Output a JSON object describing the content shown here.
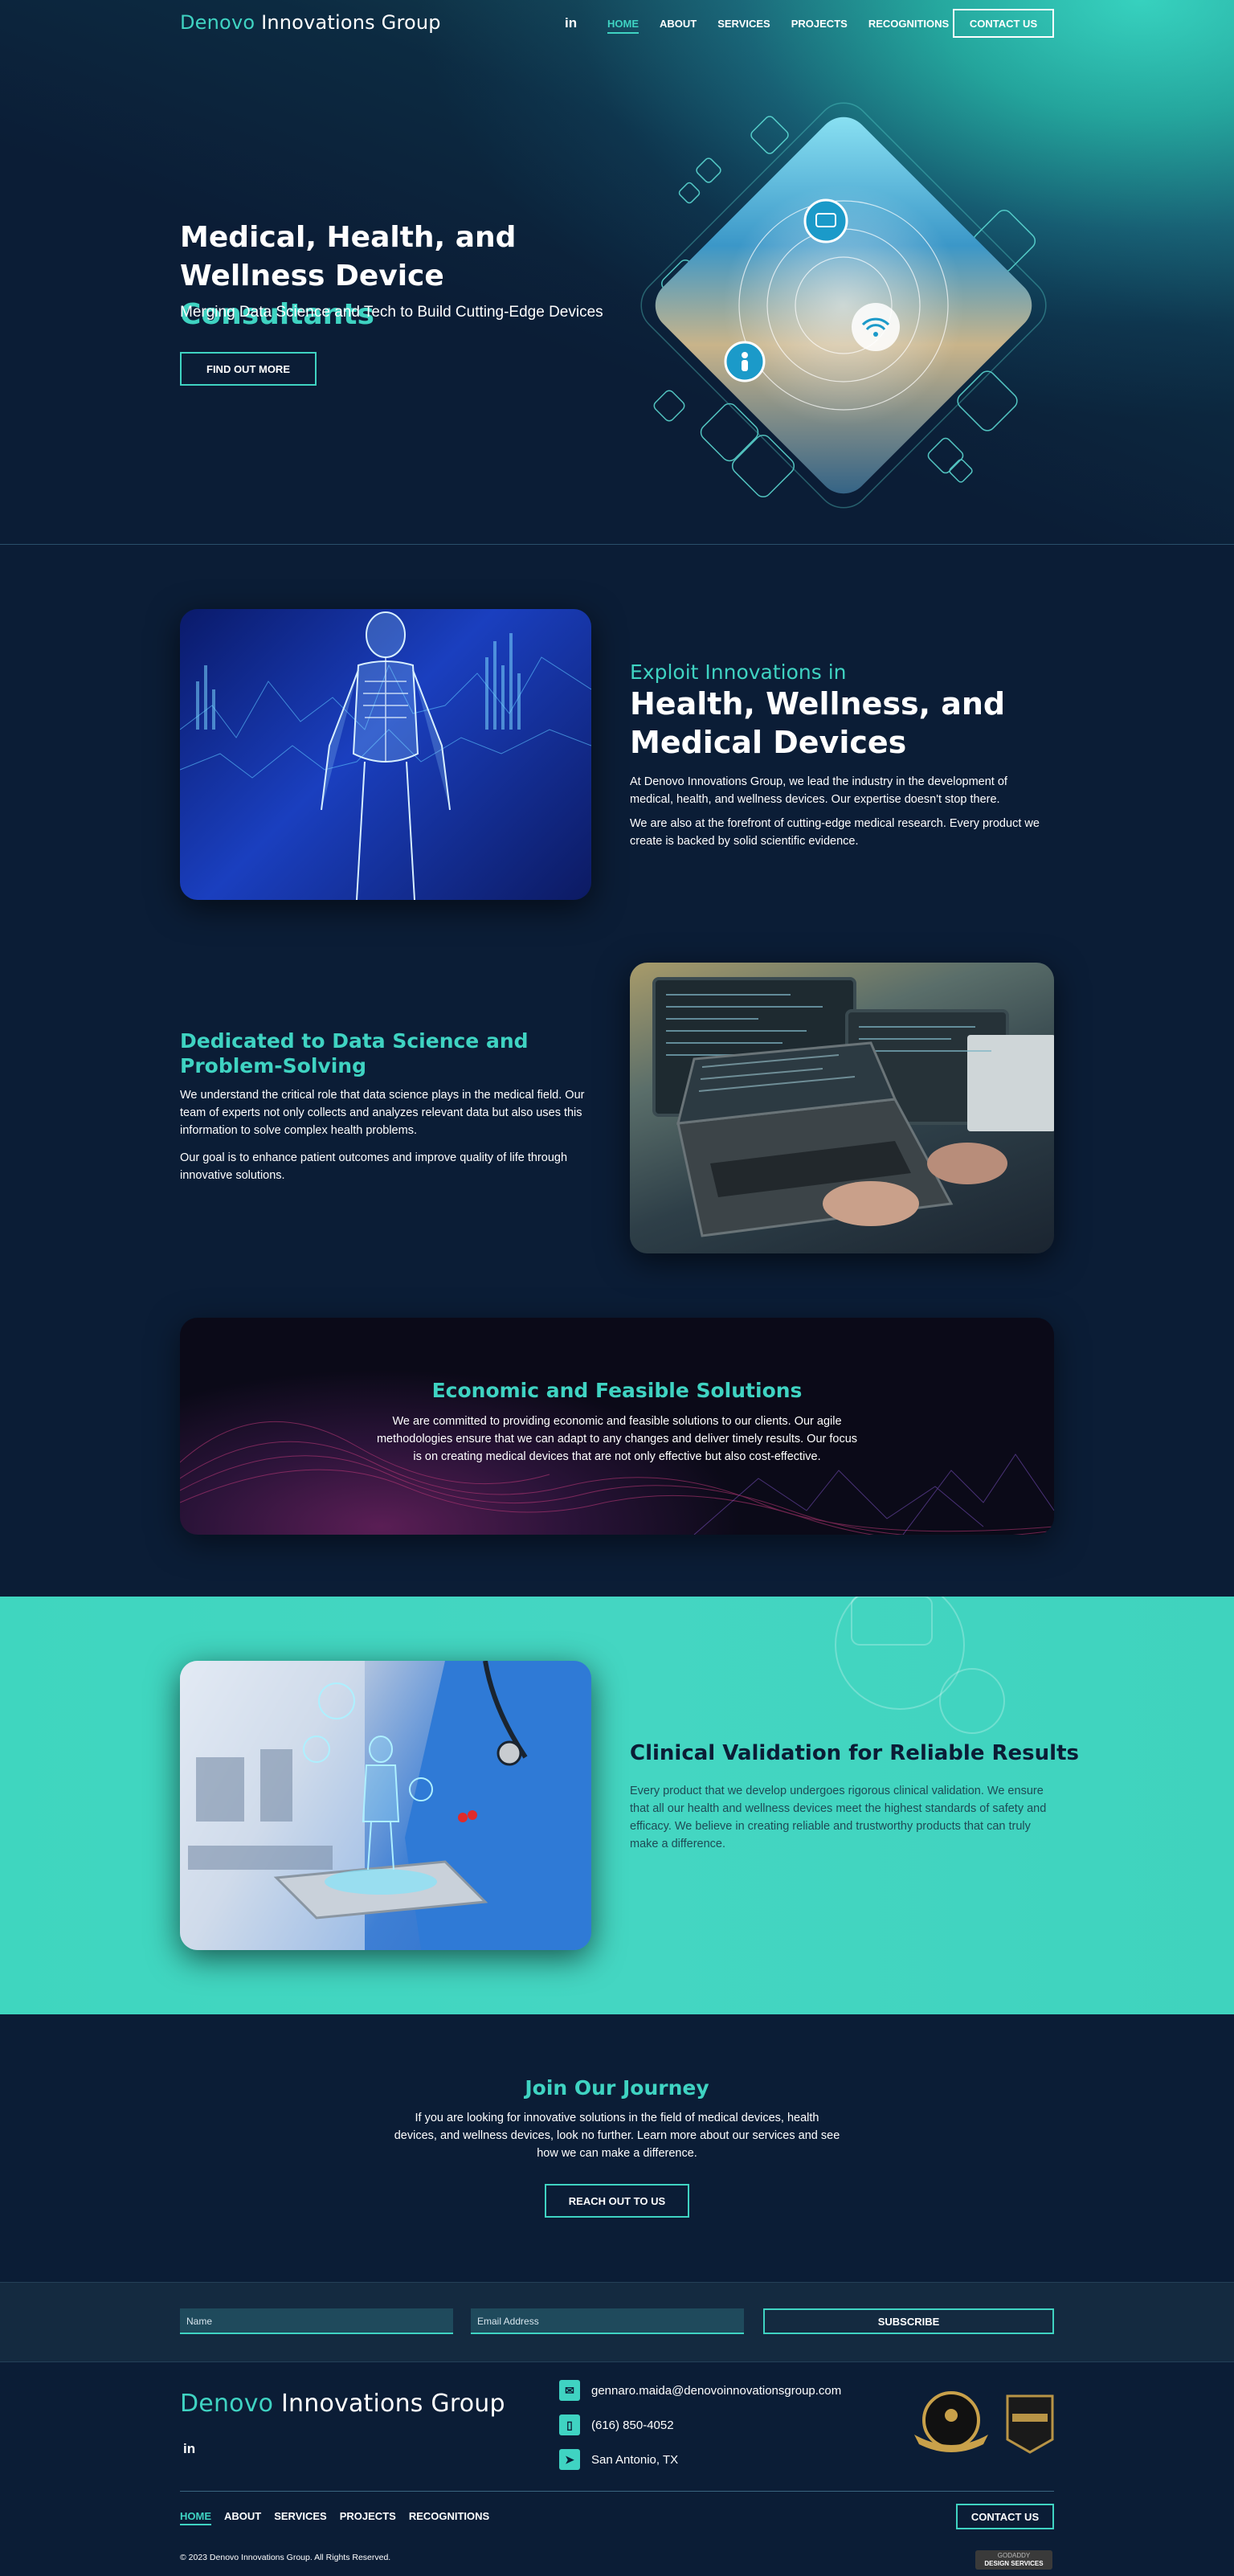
{
  "brand": {
    "accent": "Denovo",
    "rest": " Innovations Group"
  },
  "colors": {
    "accent": "#3fd3c2",
    "navy": "#0b1d36",
    "teal_bg": "#44d6c2"
  },
  "header": {
    "linkedin_glyph": "in",
    "nav": [
      "HOME",
      "ABOUT",
      "SERVICES",
      "PROJECTS",
      "RECOGNITIONS"
    ],
    "active_nav": "HOME",
    "contact_label": "CONTACT US"
  },
  "hero": {
    "title_line1": "Medical, Health, and",
    "title_line2_a": "Wellness Device ",
    "title_line2_b": "Consultants",
    "subtitle": "Merging Data Science and Tech to Build Cutting-Edge Devices",
    "cta_label": "FIND OUT MORE"
  },
  "innovations": {
    "eyebrow": "Exploit Innovations in",
    "heading_line1": "Health, Wellness, and",
    "heading_line2": "Medical Devices",
    "p1": "At Denovo Innovations Group, we lead the industry in the development of medical, health, and wellness devices. Our expertise doesn't stop there.",
    "p2": "We are also at the forefront of cutting-edge medical research. Every product we create is backed by solid scientific evidence."
  },
  "data_science": {
    "heading": "Dedicated to Data Science and Problem-Solving",
    "p1": "We understand the critical role that data science plays in the medical field. Our team of experts not only collects and analyzes relevant data but also uses this information to solve complex health problems.",
    "p2": "Our goal is to enhance patient outcomes and improve quality of life through innovative solutions."
  },
  "economic": {
    "heading": "Economic and Feasible Solutions",
    "text": "We are committed to providing economic and feasible solutions to our clients. Our agile methodologies ensure that we can adapt to any changes and deliver timely results. Our focus is on creating medical devices that are not only effective but also cost-effective."
  },
  "clinical": {
    "heading": "Clinical Validation for Reliable Results",
    "text": "Every product that we develop undergoes rigorous clinical validation. We ensure that all our health and wellness devices meet the highest standards of safety and efficacy. We believe in creating reliable and trustworthy products that can truly make a difference."
  },
  "join": {
    "heading": "Join Our Journey",
    "text": "If you are looking for innovative solutions in the field of medical devices, health devices, and wellness devices, look no further. Learn more about our services and see how we can make a difference.",
    "cta_label": "REACH OUT TO US"
  },
  "newsletter": {
    "name_placeholder": "Name",
    "email_placeholder": "Email Address",
    "subscribe_label": "SUBSCRIBE"
  },
  "footer": {
    "email": "gennaro.maida@denovoinnovationsgroup.com",
    "phone": "(616) 850-4052",
    "location": "San Antonio, TX",
    "contact_label": "CONTACT US",
    "copyright": "© 2023 Denovo Innovations Group. All Rights Reserved.",
    "badge_text": "GODADDY",
    "badge_sub": "DESIGN SERVICES"
  },
  "icons": {
    "linkedin": "linkedin-icon",
    "email": "envelope-icon",
    "phone": "phone-icon",
    "location": "location-arrow-icon"
  }
}
